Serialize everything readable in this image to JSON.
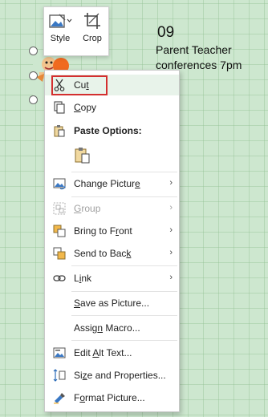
{
  "calendar": {
    "day_number": "09",
    "event_text": "Parent Teacher conferences 7pm"
  },
  "mini_toolbar": {
    "style_label": "Style",
    "crop_label": "Crop"
  },
  "context_menu": {
    "cut": {
      "pre": "Cu",
      "key": "t",
      "post": ""
    },
    "copy": {
      "pre": "",
      "key": "C",
      "post": "opy"
    },
    "paste_options": "Paste Options:",
    "change_picture": {
      "pre": "Change Pictur",
      "key": "e",
      "post": ""
    },
    "group": {
      "pre": "",
      "key": "G",
      "post": "roup"
    },
    "bring_to_front": {
      "pre": "Bring to F",
      "key": "r",
      "post": "ont"
    },
    "send_to_back": {
      "pre": "Send to Bac",
      "key": "k",
      "post": ""
    },
    "link": {
      "pre": "L",
      "key": "i",
      "post": "nk"
    },
    "save_as_picture": {
      "pre": "",
      "key": "S",
      "post": "ave as Picture..."
    },
    "assign_macro": {
      "pre": "Assig",
      "key": "n",
      "post": " Macro..."
    },
    "edit_alt_text": {
      "pre": "Edit ",
      "key": "A",
      "post": "lt Text..."
    },
    "size_and_properties": {
      "pre": "Si",
      "key": "z",
      "post": "e and Properties..."
    },
    "format_picture": {
      "pre": "F",
      "key": "o",
      "post": "rmat Picture..."
    },
    "submenu_arrow": "›"
  },
  "colors": {
    "highlight_border": "#d32f2f",
    "hover_background": "#e8f3ea",
    "sheet_background": "#cde7cf"
  }
}
